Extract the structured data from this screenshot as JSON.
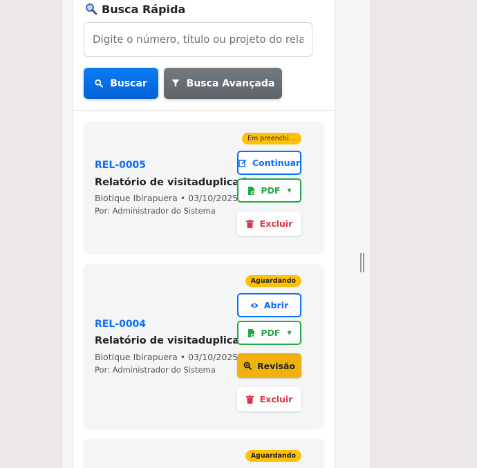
{
  "quick_search": {
    "title": "Busca Rápida",
    "placeholder": "Digite o número, título ou projeto do relatório",
    "search_label": "Buscar",
    "advanced_label": "Busca Avançada"
  },
  "reports": [
    {
      "id": "REL-0005",
      "title": "Relatório de visitaduplicado",
      "client_date": "Biotique Ibirapuera • 03/10/2025",
      "author": "Por: Administrador do Sistema",
      "status": "Em preenchimento",
      "primary_label": "Continuar",
      "pdf_label": "PDF",
      "delete_label": "Excluir"
    },
    {
      "id": "REL-0004",
      "title": "Relatório de visitaduplicado",
      "client_date": "Biotique Ibirapuera • 03/10/2025",
      "author": "Por: Administrador do Sistema",
      "status": "Aguardando",
      "primary_label": "Abrir",
      "pdf_label": "PDF",
      "review_label": "Revisão",
      "delete_label": "Excluir"
    },
    {
      "status": "Aguardando"
    }
  ],
  "colors": {
    "primary": "#0d6efd",
    "success": "#28a745",
    "warning": "#ffc107",
    "danger": "#dc3545",
    "secondary": "#6c757d"
  }
}
